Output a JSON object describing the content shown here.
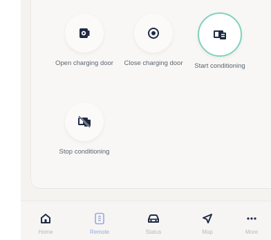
{
  "actions": [
    {
      "label": "Open charging door",
      "icon": "charging-door-open-icon"
    },
    {
      "label": "Close charging door",
      "icon": "charging-door-close-icon"
    },
    {
      "label": "Start conditioning",
      "icon": "climate-start-icon",
      "selected": true
    },
    {
      "label": "Stop conditioning",
      "icon": "climate-stop-icon"
    }
  ],
  "nav": [
    {
      "label": "Home",
      "icon": "home-icon"
    },
    {
      "label": "Remote",
      "icon": "remote-icon",
      "active": true
    },
    {
      "label": "Status",
      "icon": "car-icon"
    },
    {
      "label": "Map",
      "icon": "navigation-arrow-icon"
    },
    {
      "label": "More",
      "icon": "more-icon"
    }
  ],
  "colors": {
    "accent": "#7ed3bd",
    "icon": "#1f2a44",
    "nav_active": "#9aa7df",
    "label": "#5b6470"
  }
}
